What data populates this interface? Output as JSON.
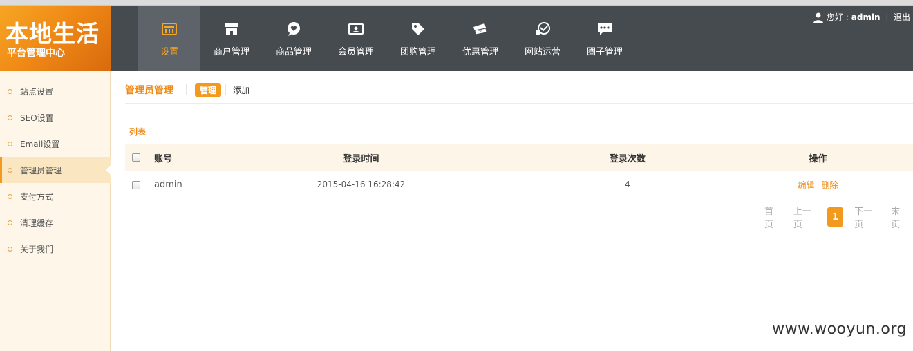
{
  "logo": {
    "title": "本地生活",
    "subtitle": "平台管理中心"
  },
  "nav": [
    {
      "label": "设置",
      "icon": "settings-icon",
      "active": true
    },
    {
      "label": "商户管理",
      "icon": "store-icon"
    },
    {
      "label": "商品管理",
      "icon": "heart-bubble-icon"
    },
    {
      "label": "会员管理",
      "icon": "member-card-icon"
    },
    {
      "label": "团购管理",
      "icon": "tag-icon"
    },
    {
      "label": "优惠管理",
      "icon": "coupon-icon"
    },
    {
      "label": "网站运营",
      "icon": "operations-icon"
    },
    {
      "label": "圈子管理",
      "icon": "chat-bubble-icon"
    }
  ],
  "user": {
    "greeting": "您好 : ",
    "name": "admin",
    "separator": "|",
    "logout": "退出"
  },
  "sidebar": {
    "items": [
      {
        "label": "站点设置"
      },
      {
        "label": "SEO设置"
      },
      {
        "label": "Email设置"
      },
      {
        "label": "管理员管理",
        "active": true
      },
      {
        "label": "支付方式"
      },
      {
        "label": "清理缓存"
      },
      {
        "label": "关于我们"
      }
    ]
  },
  "page": {
    "title": "管理员管理",
    "manage_tab": "管理",
    "add_tab": "添加",
    "list_label": "列表"
  },
  "table": {
    "headers": {
      "account": "账号",
      "login_time": "登录时间",
      "login_count": "登录次数",
      "actions": "操作"
    },
    "rows": [
      {
        "account": "admin",
        "login_time": "2015-04-16 16:28:42",
        "login_count": "4",
        "edit": "编辑",
        "sep": "|",
        "delete": "删除"
      }
    ]
  },
  "pager": {
    "first": "首页",
    "prev": "上一页",
    "current": "1",
    "next": "下一页",
    "last": "末页"
  },
  "watermark": "www.wooyun.org",
  "colors": {
    "accent": "#f39a1e",
    "header_bg": "#464b50",
    "sidebar_bg": "#fdf6e9"
  }
}
